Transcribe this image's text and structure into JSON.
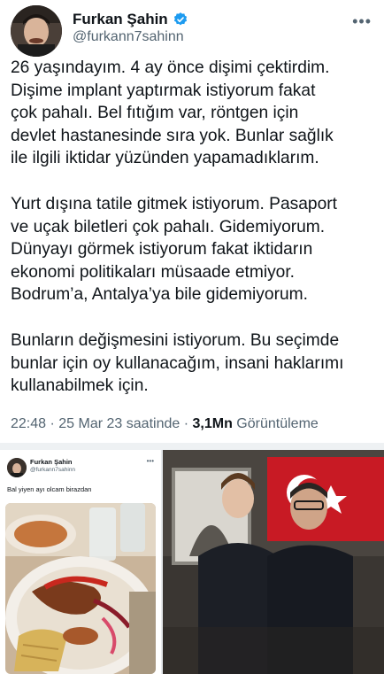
{
  "tweet": {
    "author_name": "Furkan Şahin",
    "handle": "@furkann7sahinn",
    "more_icon": "more-horizontal-icon",
    "verified_icon": "verified-badge-icon",
    "paragraphs": [
      [
        "26 yaşındayım. 4 ay önce dişimi çektirdim.",
        "Dişime implant yaptırmak istiyorum fakat",
        "çok pahalı. Bel fıtığım var, röntgen için",
        "devlet hastanesinde sıra yok. Bunlar sağlık",
        "ile ilgili iktidar yüzünden yapamadıklarım."
      ],
      [
        "Yurt dışına tatile gitmek istiyorum. Pasaport",
        "ve uçak biletleri çok pahalı. Gidemiyorum.",
        "Dünyayı görmek istiyorum fakat iktidarın",
        "ekonomi politikaları müsaade etmiyor.",
        "Bodrum’a, Antalya’ya bile gidemiyorum."
      ],
      [
        "Bunların değişmesini istiyorum. Bu seçimde",
        "bunlar için oy kullanacağım, insani haklarımı",
        "kullanabilmek için."
      ]
    ],
    "time": "22:48",
    "date": "25 Mar 23 saatinde",
    "views_count": "3,1Mn",
    "views_label": "Görüntüleme"
  },
  "embedded_tweet": {
    "author_name": "Furkan Şahin",
    "handle": "@furkann7sahinn",
    "text": "Bal yiyen ayı olcam birazdan"
  },
  "colors": {
    "text": "#0f1419",
    "muted": "#536471",
    "verified": "#1d9bf0"
  }
}
